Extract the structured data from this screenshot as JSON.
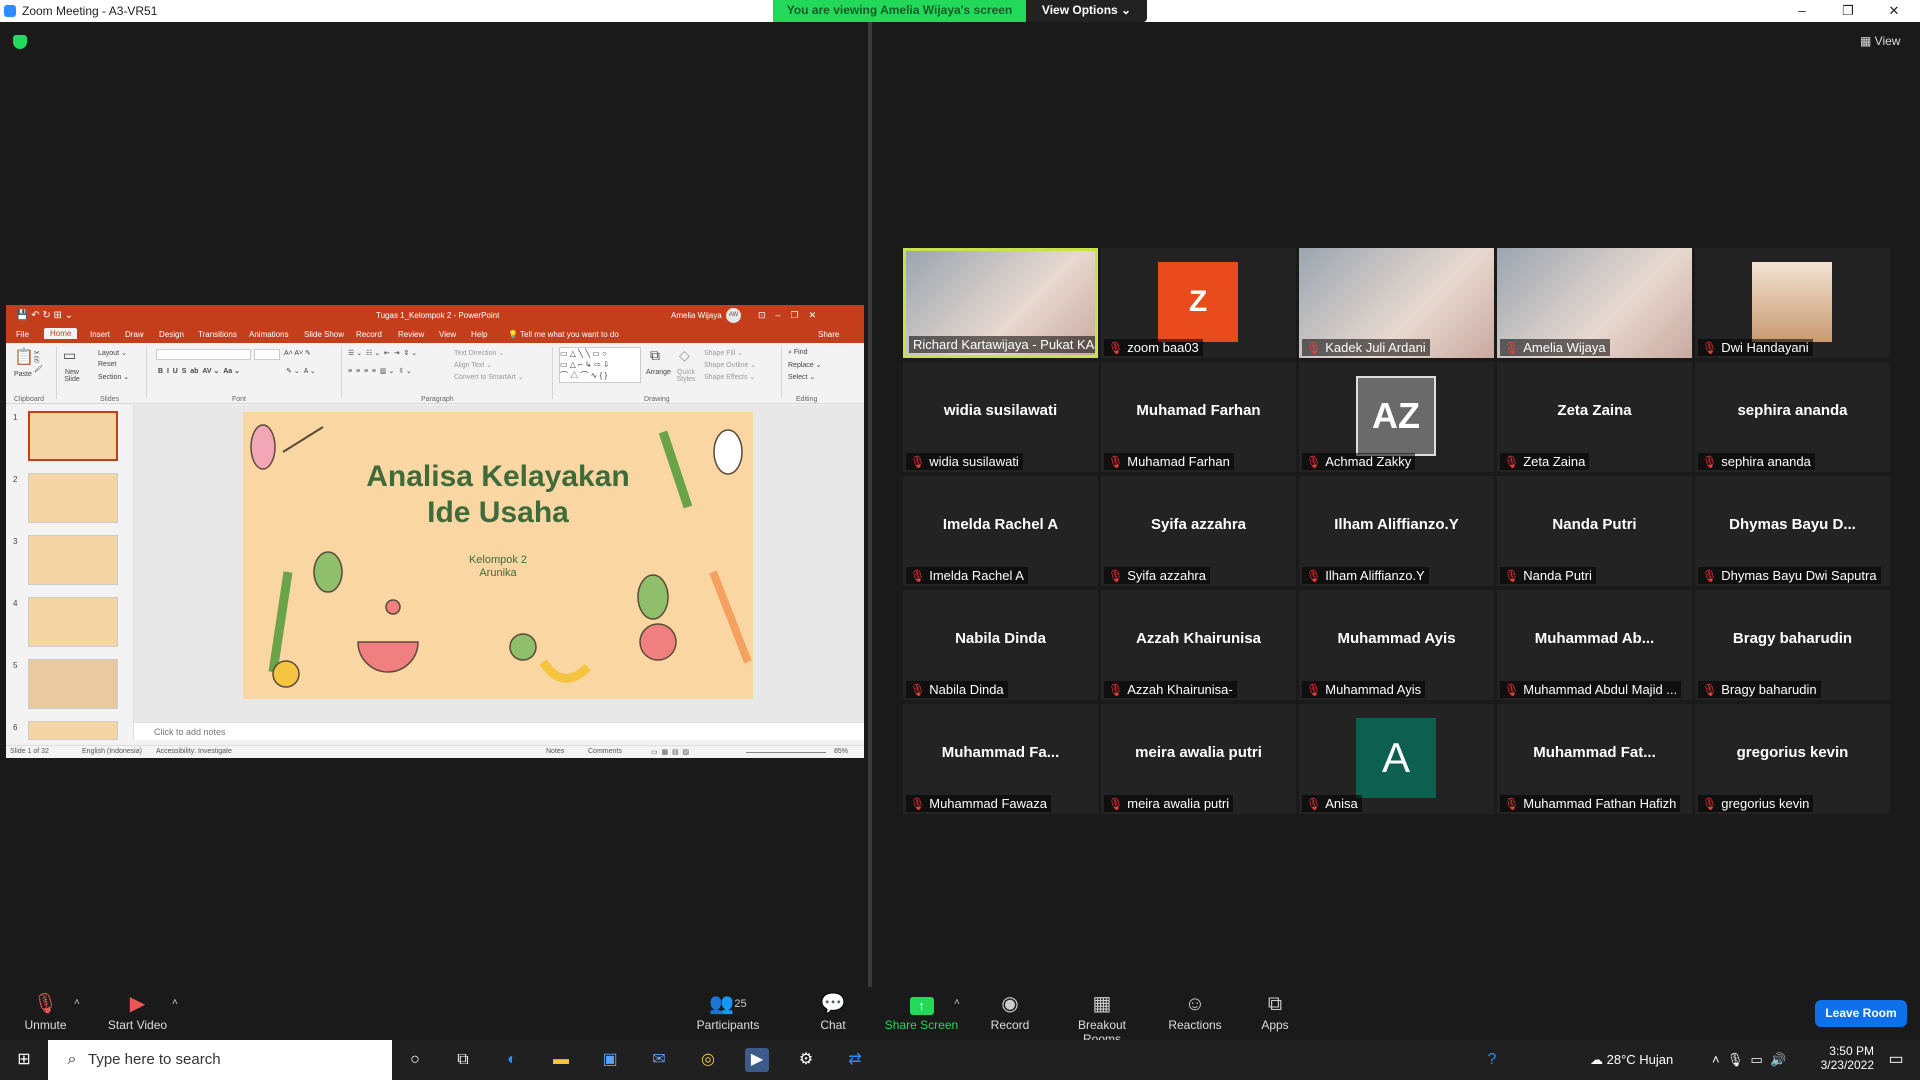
{
  "window": {
    "title": "Zoom Meeting - A3-VR51",
    "minimize": "–",
    "maximize": "❐",
    "close": "✕"
  },
  "banner": {
    "viewing": "You are viewing Amelia Wijaya's screen",
    "view_options": "View Options ⌄"
  },
  "view_label": "▦ View",
  "ppt": {
    "doc_title": "Tugas 1_Kelompok 2 - PowerPoint",
    "user": "Amelia Wijaya",
    "user_initials": "AW",
    "tabs": [
      "File",
      "Home",
      "Insert",
      "Draw",
      "Design",
      "Transitions",
      "Animations",
      "Slide Show",
      "Record",
      "Review",
      "View",
      "Help"
    ],
    "tell_me": "Tell me what you want to do",
    "share": "Share",
    "ribbon": {
      "paste": "Paste",
      "new_slide": "New Slide",
      "layout": "Layout ⌄",
      "reset": "Reset",
      "section": "Section ⌄",
      "text_direction": "Text Direction ⌄",
      "align_text": "Align Text ⌄",
      "convert": "Convert to SmartArt ⌄",
      "arrange": "Arrange",
      "quick_styles": "Quick Styles",
      "shape_fill": "Shape Fill ⌄",
      "shape_outline": "Shape Outline ⌄",
      "shape_effects": "Shape Effects ⌄",
      "find": "Find",
      "replace": "Replace ⌄",
      "select": "Select ⌄",
      "groups": [
        "Clipboard",
        "Slides",
        "Font",
        "Paragraph",
        "Drawing",
        "Editing"
      ]
    },
    "thumbs": [
      "1",
      "2",
      "3",
      "4",
      "5",
      "6"
    ],
    "slide": {
      "title_line1": "Analisa Kelayakan",
      "title_line2": "Ide Usaha",
      "sub_line1": "Kelompok 2",
      "sub_line2": "Arunika"
    },
    "notes_placeholder": "Click to add notes",
    "status": {
      "slide_of": "Slide 1 of 32",
      "language": "English (Indonesia)",
      "accessibility": "Accessibility: Investigate",
      "notes": "Notes",
      "comments": "Comments",
      "zoom": "85%"
    }
  },
  "participants": [
    {
      "center": "",
      "label": "Richard Kartawijaya - Pukat KAJ",
      "type": "video",
      "muted": false
    },
    {
      "center": "",
      "label": "zoom baa03",
      "type": "letter-z",
      "letter": "Z",
      "muted": true
    },
    {
      "center": "",
      "label": "Kadek Juli Ardani",
      "type": "video",
      "muted": true
    },
    {
      "center": "",
      "label": "Amelia Wijaya",
      "type": "video",
      "muted": true
    },
    {
      "center": "",
      "label": "Dwi Handayani",
      "type": "photo",
      "muted": true
    },
    {
      "center": "widia susilawati",
      "label": "widia susilawati",
      "type": "name",
      "muted": true
    },
    {
      "center": "Muhamad Farhan",
      "label": "Muhamad Farhan",
      "type": "name",
      "muted": true
    },
    {
      "center": "",
      "label": "Achmad Zakky",
      "type": "logo",
      "letter": "AZ",
      "muted": true
    },
    {
      "center": "Zeta Zaina",
      "label": "Zeta Zaina",
      "type": "name",
      "muted": true
    },
    {
      "center": "sephira ananda",
      "label": "sephira ananda",
      "type": "name",
      "muted": true
    },
    {
      "center": "Imelda Rachel A",
      "label": "Imelda Rachel A",
      "type": "name",
      "muted": true
    },
    {
      "center": "Syifa azzahra",
      "label": "Syifa azzahra",
      "type": "name",
      "muted": true
    },
    {
      "center": "Ilham Aliffianzo.Y",
      "label": "Ilham Aliffianzo.Y",
      "type": "name",
      "muted": true
    },
    {
      "center": "Nanda Putri",
      "label": "Nanda Putri",
      "type": "name",
      "muted": true
    },
    {
      "center": "Dhymas Bayu D...",
      "label": "Dhymas Bayu Dwi Saputra",
      "type": "name",
      "muted": true
    },
    {
      "center": "Nabila Dinda",
      "label": "Nabila Dinda",
      "type": "name",
      "muted": true
    },
    {
      "center": "Azzah Khairunisa",
      "label": "Azzah Khairunisa-",
      "type": "name",
      "muted": true
    },
    {
      "center": "Muhammad Ayis",
      "label": "Muhammad Ayis",
      "type": "name",
      "muted": true
    },
    {
      "center": "Muhammad Ab...",
      "label": "Muhammad Abdul Majid ...",
      "type": "name",
      "muted": true
    },
    {
      "center": "Bragy baharudin",
      "label": "Bragy baharudin",
      "type": "name",
      "muted": true
    },
    {
      "center": "Muhammad Fa...",
      "label": "Muhammad Fawaza",
      "type": "name",
      "muted": true
    },
    {
      "center": "meira awalia putri",
      "label": "meira awalia putri",
      "type": "name",
      "muted": true
    },
    {
      "center": "",
      "label": "Anisa",
      "type": "letter-a",
      "letter": "A",
      "muted": true
    },
    {
      "center": "Muhammad Fat...",
      "label": "Muhammad Fathan Hafizh",
      "type": "name",
      "muted": true
    },
    {
      "center": "gregorius kevin",
      "label": "gregorius kevin",
      "type": "name",
      "muted": true
    }
  ],
  "toolbar": {
    "unmute": "Unmute",
    "start_video": "Start Video",
    "participants": "Participants",
    "participants_count": "25",
    "chat": "Chat",
    "share_screen": "Share Screen",
    "record": "Record",
    "breakout": "Breakout Rooms",
    "reactions": "Reactions",
    "apps": "Apps",
    "leave": "Leave Room"
  },
  "taskbar": {
    "search_placeholder": "Type here to search",
    "weather": "28°C  Hujan",
    "time": "3:50 PM",
    "date": "3/23/2022"
  },
  "colors": {
    "zoom_green": "#23d959",
    "ppt_red": "#c43e1c",
    "leave_blue": "#0e71eb",
    "active_speaker": "#c8e34a"
  }
}
